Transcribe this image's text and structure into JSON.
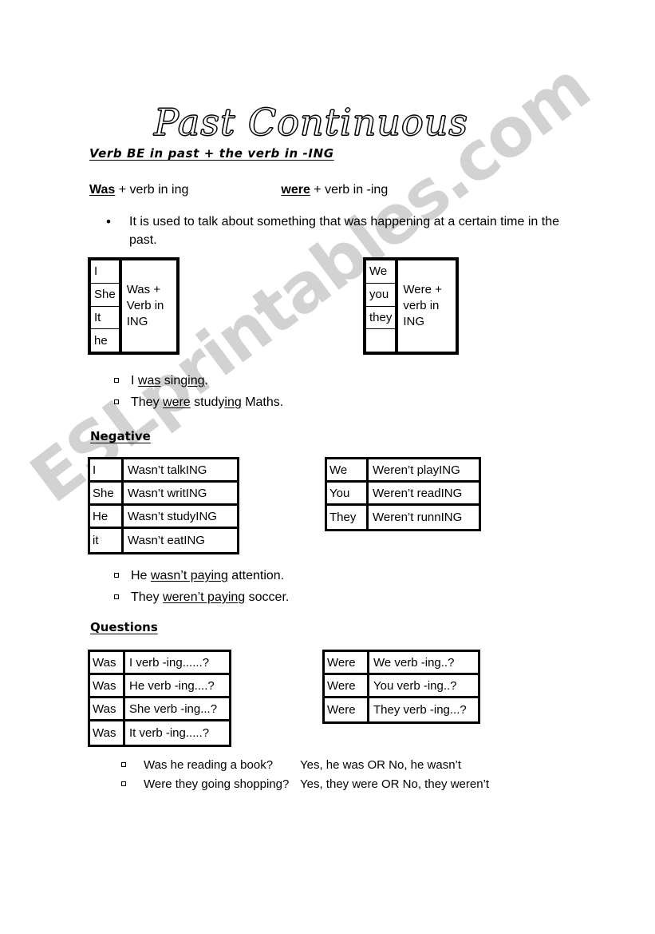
{
  "watermark": {
    "text": "ESLprintables.com",
    "color": "#d2d2d2"
  },
  "title": "Past Continuous",
  "subtitle": "Verb BE in past + the verb in -ING",
  "formula": {
    "was_key": "Was",
    "was_rest": " + verb in ing",
    "were_key": "were",
    "were_rest": " + verb in -ing"
  },
  "intro": {
    "bullet": "•",
    "text": "It is used to talk about something that was happening at a certain time in the past."
  },
  "affirmative_tables": [
    {
      "name": "was",
      "subjects": [
        "I",
        "She",
        "It",
        "he"
      ],
      "predicate": "Was + Verb in ING"
    },
    {
      "name": "were",
      "subjects": [
        "We",
        "you",
        "they",
        ""
      ],
      "predicate": "Were + verb in ING"
    }
  ],
  "examples_affirmative": [
    {
      "parts": [
        {
          "t": "I ",
          "u": false
        },
        {
          "t": "was",
          "u": true
        },
        {
          "t": " sing",
          "u": false
        },
        {
          "t": "ing",
          "u": true
        },
        {
          "t": ".",
          "u": false
        }
      ]
    },
    {
      "parts": [
        {
          "t": "They ",
          "u": false
        },
        {
          "t": "were",
          "u": true
        },
        {
          "t": " study",
          "u": false
        },
        {
          "t": "ing",
          "u": true
        },
        {
          "t": " Maths.",
          "u": false
        }
      ]
    }
  ],
  "heading_negative": "Negative",
  "negative_tables": [
    {
      "name": "was",
      "rows": [
        {
          "subject": "I",
          "predicate": "Wasn’t talkING"
        },
        {
          "subject": "She",
          "predicate": "Wasn’t  writING"
        },
        {
          "subject": "He",
          "predicate": "Wasn’t studyING"
        },
        {
          "subject": "it",
          "predicate": "Wasn’t eatING"
        }
      ]
    },
    {
      "name": "were",
      "rows": [
        {
          "subject": "We",
          "predicate": "Weren’t playING"
        },
        {
          "subject": "You",
          "predicate": "Weren’t readING"
        },
        {
          "subject": "They",
          "predicate": "Weren’t runnING"
        }
      ]
    }
  ],
  "examples_negative": [
    {
      "parts": [
        {
          "t": "He ",
          "u": false
        },
        {
          "t": "wasn’t pay",
          "u": true
        },
        {
          "t": "ing",
          "u": true
        },
        {
          "t": " attention.",
          "u": false
        }
      ]
    },
    {
      "parts": [
        {
          "t": "They ",
          "u": false
        },
        {
          "t": "weren’t pay",
          "u": true
        },
        {
          "t": "ing",
          "u": true
        },
        {
          "t": " soccer.",
          "u": false
        }
      ]
    }
  ],
  "heading_questions": "Questions",
  "question_tables": [
    {
      "name": "was",
      "rows": [
        {
          "aux": "Was",
          "rest": "I verb -ing......?"
        },
        {
          "aux": "Was",
          "rest": "He verb -ing....?"
        },
        {
          "aux": "Was",
          "rest": "She verb  -ing...?"
        },
        {
          "aux": "Was",
          "rest": "It verb -ing.....?"
        }
      ]
    },
    {
      "name": "were",
      "rows": [
        {
          "aux": "Were",
          "rest": "We verb -ing..?"
        },
        {
          "aux": "Were",
          "rest": "You verb -ing..?"
        },
        {
          "aux": "Were",
          "rest": "They verb -ing...?"
        }
      ]
    }
  ],
  "examples_questions": [
    {
      "question": "Was he reading a book?",
      "answer": "Yes, he was OR No, he wasn’t"
    },
    {
      "question": "Were they going shopping?",
      "answer": "Yes, they were  OR No, they weren’t"
    }
  ]
}
